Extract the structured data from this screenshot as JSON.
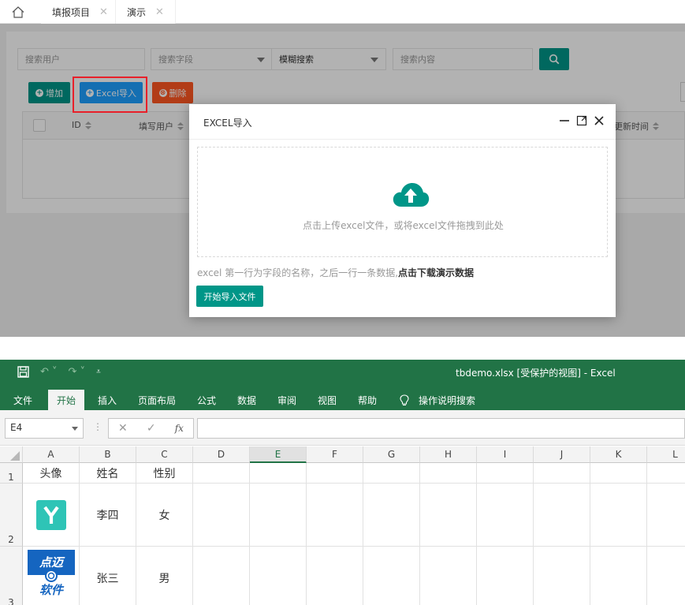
{
  "app": {
    "tabs": [
      {
        "label": "填报项目",
        "close": "✕"
      },
      {
        "label": "演示",
        "close": "✕"
      }
    ],
    "search": {
      "user_placeholder": "搜索用户",
      "field_placeholder": "搜索字段",
      "mode_value": "模糊搜索",
      "content_placeholder": "搜索内容"
    },
    "toolbar": {
      "add_label": "增加",
      "import_label": "Excel导入",
      "delete_label": "删除"
    },
    "table": {
      "columns": [
        "ID",
        "填写用户",
        "更新时间"
      ]
    },
    "colors": {
      "primary": "#009688",
      "import_button": "#1e9fff",
      "delete_button": "#ff5722",
      "highlight_box": "#e8202a"
    }
  },
  "modal": {
    "title": "EXCEL导入",
    "upload_tip": "点击上传excel文件，或将excel文件拖拽到此处",
    "note_prefix": "excel 第一行为字段的名称，之后一行一条数据,",
    "note_link": "点击下载演示数据",
    "start_button": "开始导入文件"
  },
  "excel": {
    "document_title": "tbdemo.xlsx  [受保护的视图]  -  Excel",
    "ribbon_tabs": [
      "文件",
      "开始",
      "插入",
      "页面布局",
      "公式",
      "数据",
      "审阅",
      "视图",
      "帮助",
      "操作说明搜索"
    ],
    "active_tab": "开始",
    "name_box": "E4",
    "fx_label": "fx",
    "columns": [
      "A",
      "B",
      "C",
      "D",
      "E",
      "F",
      "G",
      "H",
      "I",
      "J",
      "K",
      "L"
    ],
    "selected_column": "E",
    "rows": [
      {
        "num": "1",
        "cells": [
          "头像",
          "姓名",
          "性别"
        ]
      },
      {
        "num": "2",
        "cells": [
          "",
          "李四",
          "女"
        ]
      },
      {
        "num": "3",
        "cells": [
          "",
          "张三",
          "男"
        ]
      }
    ],
    "logo_text": {
      "top": "点迈",
      "bottom": "软件"
    },
    "colors": {
      "brand": "#217346",
      "avatar_teal": "#2ec4b6",
      "logo_blue": "#1565c0"
    }
  }
}
